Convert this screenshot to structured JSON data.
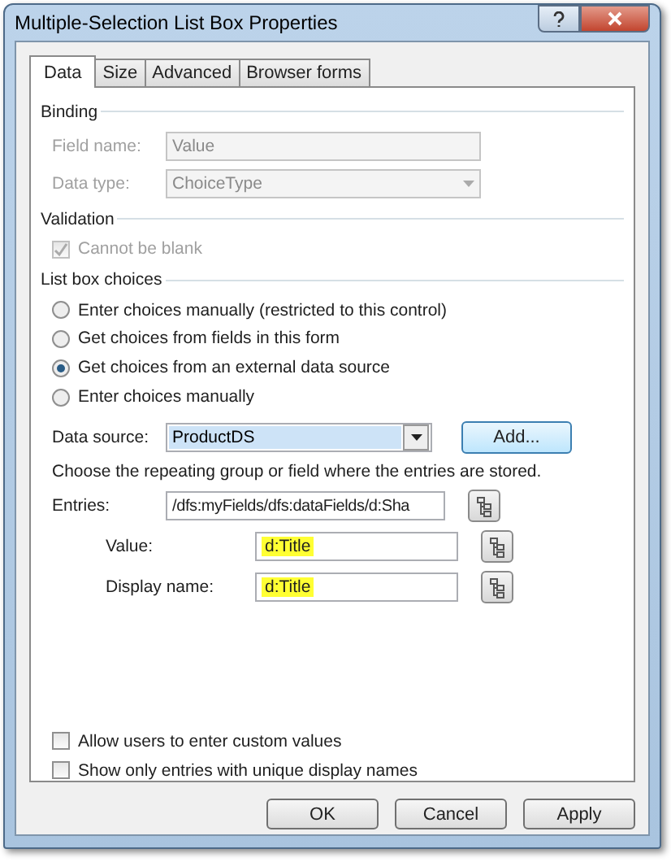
{
  "window": {
    "title": "Multiple-Selection List Box Properties"
  },
  "tabs": [
    {
      "label": "Data",
      "selected": true
    },
    {
      "label": "Size",
      "selected": false
    },
    {
      "label": "Advanced",
      "selected": false
    },
    {
      "label": "Browser forms",
      "selected": false
    }
  ],
  "binding": {
    "title": "Binding",
    "fields": [
      {
        "kind": "text",
        "label": "Field name:",
        "value": "Value",
        "disabled": true
      },
      {
        "kind": "dropdown",
        "label": "Data type:",
        "value": "ChoiceType",
        "disabled": true
      }
    ]
  },
  "validation": {
    "title": "Validation",
    "checkbox": {
      "label": "Cannot be blank",
      "checked": true,
      "disabled": true
    }
  },
  "choices": {
    "title": "List box choices",
    "options": [
      {
        "label": "Enter choices manually (restricted to this control)",
        "selected": false
      },
      {
        "label": "Get choices from fields in this form",
        "selected": false
      },
      {
        "label": "Get choices from an external data source",
        "selected": true
      },
      {
        "label": "Enter choices manually",
        "selected": false
      }
    ]
  },
  "data_source": {
    "label": "Data source:",
    "value": "ProductDS",
    "button": "Add..."
  },
  "hint": "Choose the repeating group or field where the entries are stored.",
  "entries": {
    "label": "Entries:",
    "value": "/dfs:myFields/dfs:dataFields/d:Sha"
  },
  "mappings": [
    {
      "label": "Value:",
      "value": "d:Title",
      "highlighted": true
    },
    {
      "label": "Display name:",
      "value": "d:Title",
      "highlighted": true
    }
  ],
  "options": [
    {
      "label": "Allow users to enter custom values",
      "checked": false
    },
    {
      "label": "Show only entries with unique display names",
      "checked": false
    }
  ],
  "buttons": [
    "OK",
    "Cancel",
    "Apply"
  ]
}
